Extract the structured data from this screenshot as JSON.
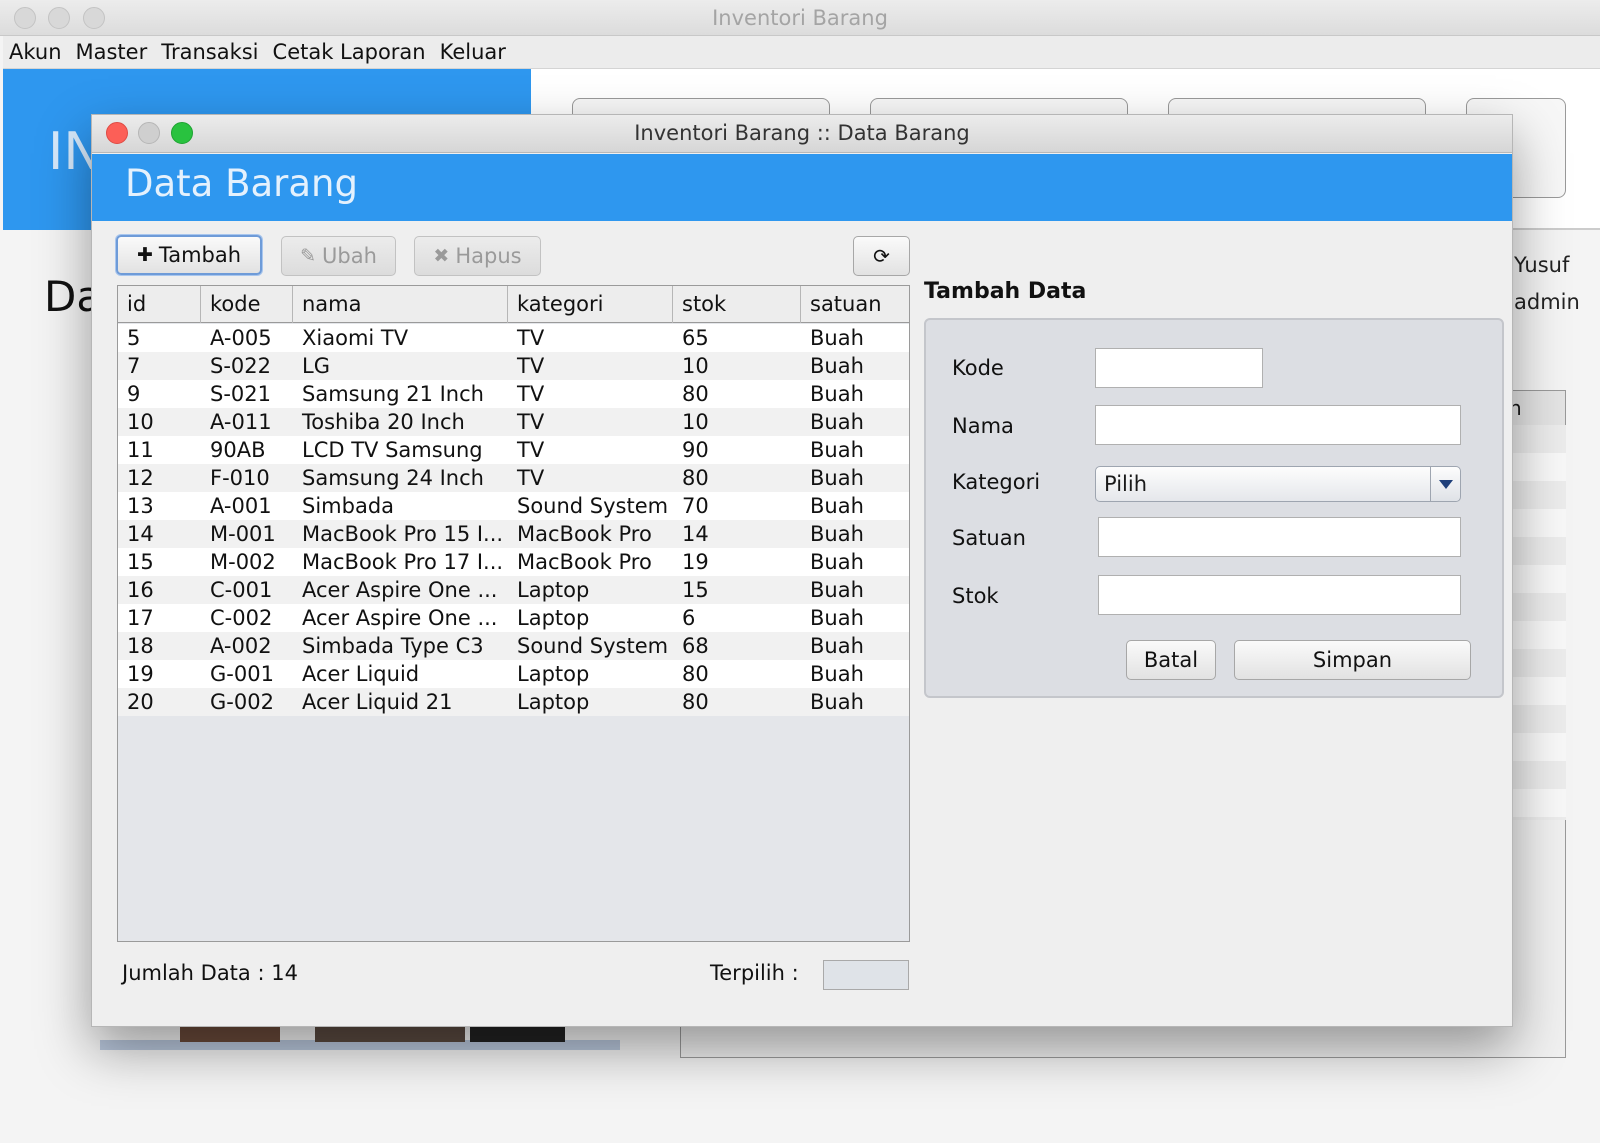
{
  "main_window": {
    "title": "Inventori Barang",
    "menu": [
      "Akun",
      "Master",
      "Transaksi",
      "Cetak Laporan",
      "Keluar"
    ],
    "banner_partial_text": "IN",
    "heading_partial_text": "Da",
    "user_name_partial": "Yusuf",
    "user_role_partial": "admin",
    "table_header_partial": "n"
  },
  "dialog": {
    "title": "Inventori Barang :: Data Barang",
    "header_title": "Data Barang",
    "toolbar": {
      "tambah_label": "Tambah",
      "ubah_label": "Ubah",
      "hapus_label": "Hapus",
      "refresh_icon": "refresh-icon"
    },
    "table": {
      "columns": [
        "id",
        "kode",
        "nama",
        "kategori",
        "stok",
        "satuan"
      ],
      "rows": [
        [
          "5",
          "A-005",
          "Xiaomi TV",
          "TV",
          "65",
          "Buah"
        ],
        [
          "7",
          "S-022",
          "LG",
          "TV",
          "10",
          "Buah"
        ],
        [
          "9",
          "S-021",
          "Samsung 21 Inch",
          "TV",
          "80",
          "Buah"
        ],
        [
          "10",
          "A-011",
          "Toshiba 20 Inch",
          "TV",
          "10",
          "Buah"
        ],
        [
          "11",
          "90AB",
          "LCD TV Samsung",
          "TV",
          "90",
          "Buah"
        ],
        [
          "12",
          "F-010",
          "Samsung 24 Inch",
          "TV",
          "80",
          "Buah"
        ],
        [
          "13",
          "A-001",
          "Simbada",
          "Sound System",
          "70",
          "Buah"
        ],
        [
          "14",
          "M-001",
          "MacBook Pro 15 I...",
          "MacBook Pro",
          "14",
          "Buah"
        ],
        [
          "15",
          "M-002",
          "MacBook Pro 17 I...",
          "MacBook Pro",
          "19",
          "Buah"
        ],
        [
          "16",
          "C-001",
          "Acer Aspire One ...",
          "Laptop",
          "15",
          "Buah"
        ],
        [
          "17",
          "C-002",
          "Acer Aspire One ...",
          "Laptop",
          "6",
          "Buah"
        ],
        [
          "18",
          "A-002",
          "Simbada Type C3",
          "Sound System",
          "68",
          "Buah"
        ],
        [
          "19",
          "G-001",
          "Acer Liquid",
          "Laptop",
          "80",
          "Buah"
        ],
        [
          "20",
          "G-002",
          "Acer Liquid 21",
          "Laptop",
          "80",
          "Buah"
        ]
      ]
    },
    "footer": {
      "jumlah_label": "Jumlah Data : 14",
      "terpilih_label": "Terpilih :",
      "terpilih_value": ""
    },
    "form": {
      "title": "Tambah Data",
      "kode_label": "Kode",
      "kode_value": "",
      "nama_label": "Nama",
      "nama_value": "",
      "kategori_label": "Kategori",
      "kategori_selected": "Pilih",
      "satuan_label": "Satuan",
      "satuan_value": "",
      "stok_label": "Stok",
      "stok_value": "",
      "batal_label": "Batal",
      "simpan_label": "Simpan"
    }
  },
  "colors": {
    "header_blue": "#2e97ef",
    "close_red": "#fc5f57",
    "maximize_green": "#29c23f"
  }
}
